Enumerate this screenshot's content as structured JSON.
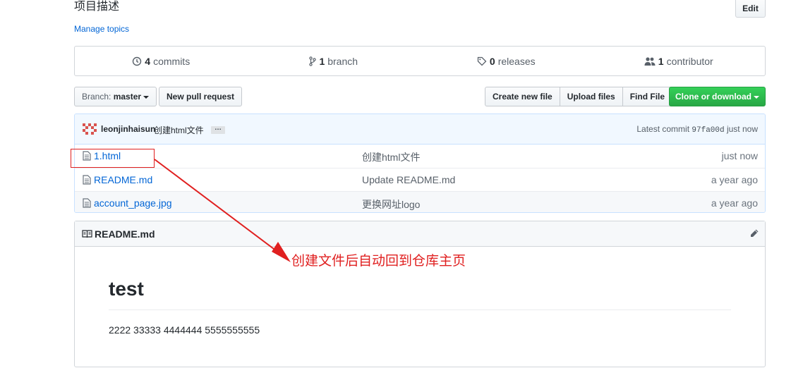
{
  "repo": {
    "description": "项目描述",
    "edit_label": "Edit",
    "manage_topics_label": "Manage topics"
  },
  "stats": {
    "commits_count": "4",
    "commits_label": "commits",
    "branch_count": "1",
    "branch_label": "branch",
    "releases_count": "0",
    "releases_label": "releases",
    "contributor_count": "1",
    "contributor_label": "contributor"
  },
  "toolbar": {
    "branch_prefix": "Branch:",
    "branch_name": "master",
    "new_pr_label": "New pull request",
    "create_file_label": "Create new file",
    "upload_files_label": "Upload files",
    "find_file_label": "Find File",
    "clone_label": "Clone or download"
  },
  "latest_commit": {
    "author": "leonjinhaisun",
    "message": "创建html文件",
    "ellipsis": "…",
    "prefix": "Latest commit",
    "sha": "97fa00d",
    "time": "just now"
  },
  "files": [
    {
      "name": "1.html",
      "message": "创建html文件",
      "age": "just now"
    },
    {
      "name": "README.md",
      "message": "Update README.md",
      "age": "a year ago"
    },
    {
      "name": "account_page.jpg",
      "message": "更换网址logo",
      "age": "a year ago"
    }
  ],
  "readme": {
    "title": "README.md",
    "heading": "test",
    "body": "2222 33333 4444444 5555555555"
  },
  "annotation": {
    "text": "创建文件后自动回到仓库主页",
    "color": "#e02020"
  },
  "colors": {
    "link": "#0366d6",
    "green": "#28a745",
    "commit_bar": "#f1f8ff"
  }
}
